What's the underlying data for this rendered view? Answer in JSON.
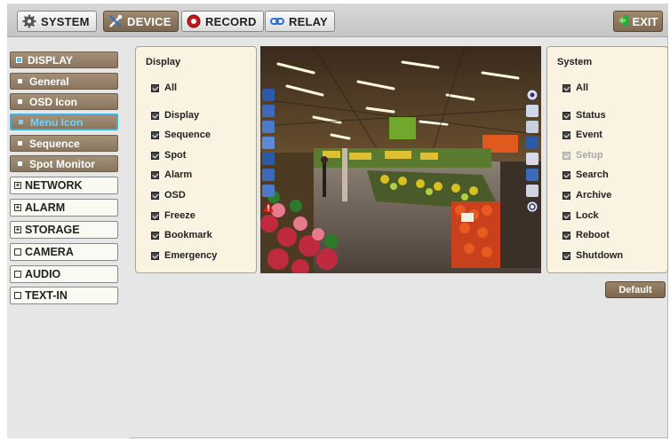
{
  "topbar": {
    "tabs": [
      {
        "label": "SYSTEM",
        "icon": "gear-icon"
      },
      {
        "label": "DEVICE",
        "icon": "tools-icon"
      },
      {
        "label": "RECORD",
        "icon": "record-icon"
      },
      {
        "label": "RELAY",
        "icon": "relay-icon"
      }
    ],
    "active_tab": "DEVICE",
    "exit_label": "EXIT"
  },
  "sidebar": {
    "items": [
      {
        "label": "DISPLAY"
      },
      {
        "label": "General"
      },
      {
        "label": "OSD Icon"
      },
      {
        "label": "Menu Icon"
      },
      {
        "label": "Sequence"
      },
      {
        "label": "Spot Monitor"
      },
      {
        "label": "NETWORK"
      },
      {
        "label": "ALARM"
      },
      {
        "label": "STORAGE"
      },
      {
        "label": "CAMERA"
      },
      {
        "label": "AUDIO"
      },
      {
        "label": "TEXT-IN"
      }
    ],
    "selected": "Menu Icon"
  },
  "display_panel": {
    "title": "Display",
    "all_label": "All",
    "items": [
      "Display",
      "Sequence",
      "Spot",
      "Alarm",
      "OSD",
      "Freeze",
      "Bookmark",
      "Emergency"
    ]
  },
  "system_panel": {
    "title": "System",
    "all_label": "All",
    "items": [
      "Status",
      "Event",
      "Setup",
      "Search",
      "Archive",
      "Lock",
      "Reboot",
      "Shutdown"
    ],
    "disabled": [
      "Setup"
    ]
  },
  "default_label": "Default",
  "colors": {
    "accent_brown": "#8a7660",
    "highlight_blue": "#3ab4e8",
    "panel_bg": "#faf3e2"
  }
}
